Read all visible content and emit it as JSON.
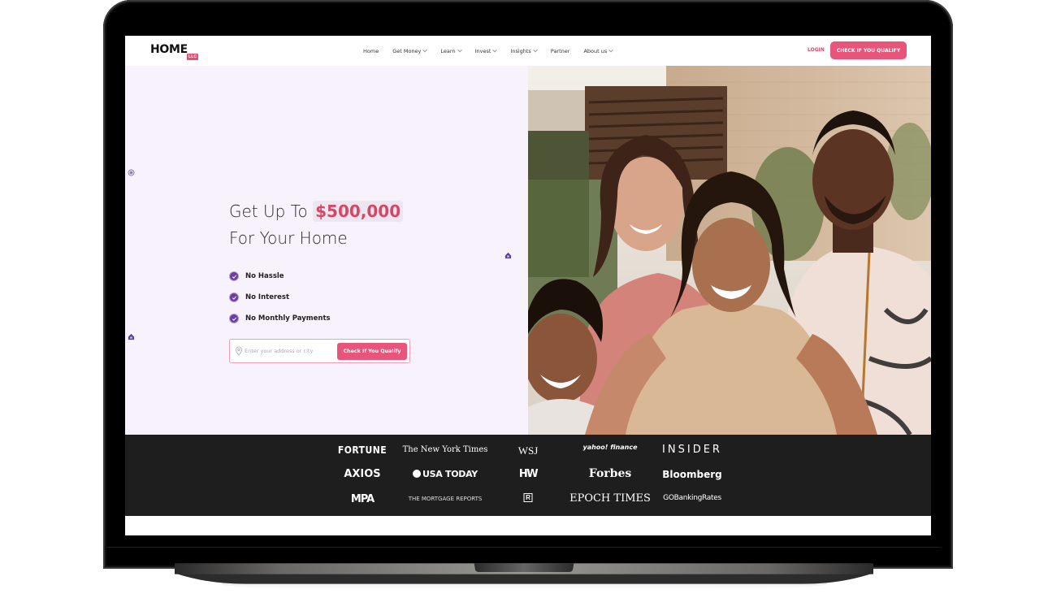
{
  "header": {
    "logo_text": "HOME",
    "logo_badge": "LLC",
    "nav": [
      {
        "label": "Home",
        "has_dropdown": false
      },
      {
        "label": "Get Money",
        "has_dropdown": true
      },
      {
        "label": "Learn",
        "has_dropdown": true
      },
      {
        "label": "Invest",
        "has_dropdown": true
      },
      {
        "label": "Insights",
        "has_dropdown": true
      },
      {
        "label": "Partner",
        "has_dropdown": false
      },
      {
        "label": "About us",
        "has_dropdown": true
      }
    ],
    "login_label": "LOGIN",
    "cta_label": "CHECK IF YOU QUALIFY"
  },
  "hero": {
    "title_prefix": "Get Up To",
    "title_amount": "$500,000",
    "title_line2": "For Your Home",
    "features": [
      {
        "label": "No Hassle",
        "icon": "check-circle-icon"
      },
      {
        "label": "No Interest",
        "icon": "check-circle-icon"
      },
      {
        "label": "No Monthly Payments",
        "icon": "check-circle-icon"
      }
    ],
    "search": {
      "value": "",
      "placeholder": "Enter your address or city",
      "icon": "map-pin-icon",
      "button_label": "Check If You Qualify"
    },
    "photo_alt": "Smiling family taking a selfie outside their home"
  },
  "press": {
    "rows": [
      [
        "FORTUNE",
        "The New York Times",
        "WSJ",
        "yahoo! finance",
        "INSIDER"
      ],
      [
        "AXIOS",
        "USA TODAY",
        "HW",
        "Forbes",
        "Bloomberg"
      ],
      [
        "MPA",
        "THE MORTGAGE REPORTS",
        "R",
        "EPOCH TIMES",
        "GOBankingRates"
      ]
    ]
  },
  "colors": {
    "brand_pink": "#e8557a",
    "amount_pink": "#d8456b",
    "check_purple": "#6b3fa0",
    "hero_bg": "#f8f2fc",
    "press_bg": "#1e1e1e"
  }
}
